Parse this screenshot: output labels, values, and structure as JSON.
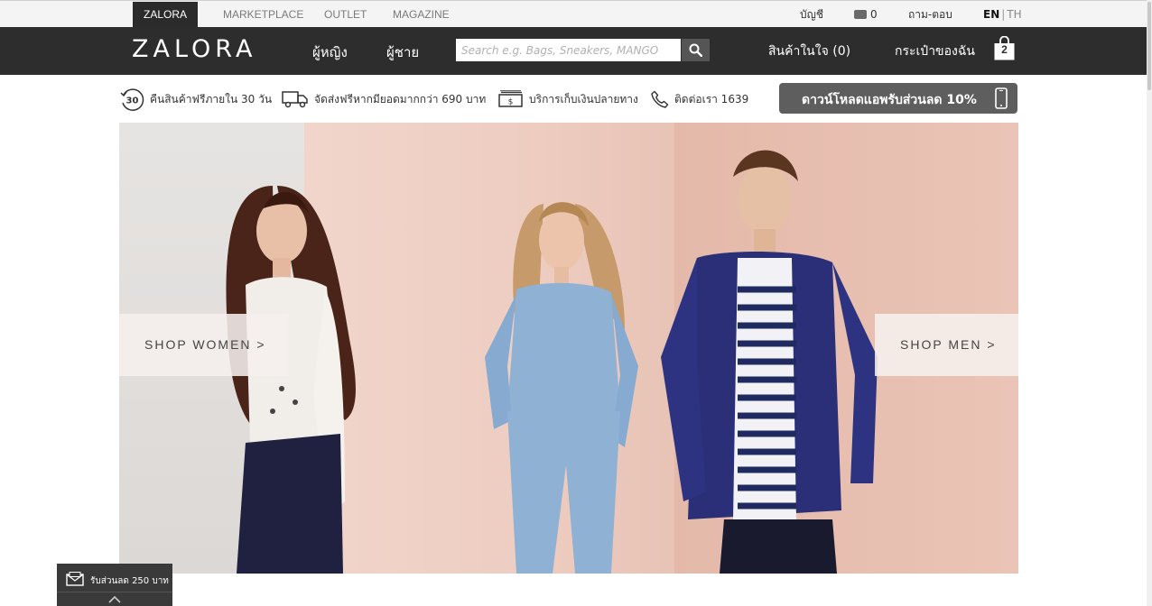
{
  "topbar": {
    "tabs": [
      "ZALORA",
      "MARKETPLACE",
      "OUTLET",
      "MAGAZINE"
    ],
    "account": "บัญชี",
    "wallet_count": "0",
    "faq": "ถาม-ตอบ",
    "lang_en": "EN",
    "lang_sep": "|",
    "lang_th": "TH"
  },
  "header": {
    "logo": "ZALORA",
    "nav": [
      "ผู้หญิง",
      "ผู้ชาย"
    ],
    "search_placeholder": "Search e.g. Bags, Sneakers, MANGO",
    "wishlist": "สินค้าในใจ (0)",
    "bag_label": "กระเป๋าของฉัน",
    "bag_count": "2"
  },
  "usp": {
    "returns_badge": "30",
    "returns": "คืนสินค้าฟรีภายใน 30 วัน",
    "shipping": "จัดส่งฟรีหากมียอดมากกว่า 690 บาท",
    "cod": "บริการเก็บเงินปลายทาง",
    "contact": "ติดต่อเรา 1639",
    "app_banner": "ดาวน์โหลดแอพรับส่วนลด 10%"
  },
  "hero": {
    "shop_women": "SHOP WOMEN >",
    "shop_men": "SHOP MEN >"
  },
  "coupon": {
    "label": "รับส่วนลด 250 บาท"
  },
  "colors": {
    "header_bg": "#2d2d2d",
    "topbar_bg": "#f4f4f4",
    "app_banner_bg": "#5e5e5e"
  },
  "icons": [
    "search-icon",
    "wallet-icon",
    "bag-icon",
    "return-30-icon",
    "truck-icon",
    "cash-icon",
    "phone-icon",
    "mobile-icon",
    "mail-icon",
    "chevron-up-icon"
  ]
}
